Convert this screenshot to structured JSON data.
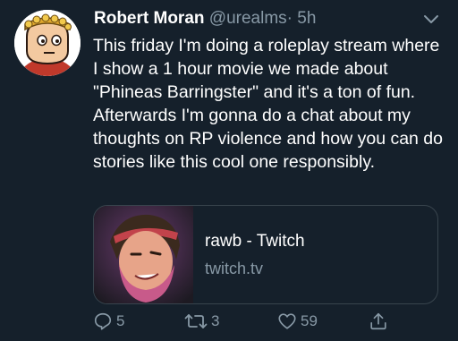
{
  "tweet": {
    "author_name": "Robert Moran",
    "handle": "@urealms",
    "separator": "·",
    "time": "5h",
    "text": "This friday I'm doing a roleplay stream where I show a 1 hour movie we made about \"Phineas Barringster\" and it's a ton of fun. Afterwards I'm gonna do a chat about my thoughts on RP violence and how you can do stories like this cool one responsibly."
  },
  "card": {
    "title": "rawb - Twitch",
    "domain": "twitch.tv"
  },
  "actions": {
    "reply_count": "5",
    "retweet_count": "3",
    "like_count": "59"
  },
  "icons": {
    "reply": "reply-icon",
    "retweet": "retweet-icon",
    "like": "heart-icon",
    "share": "share-icon",
    "menu": "chevron-down-icon"
  },
  "colors": {
    "background": "#15202b",
    "secondary_text": "#8899a6",
    "border": "#38444d"
  }
}
